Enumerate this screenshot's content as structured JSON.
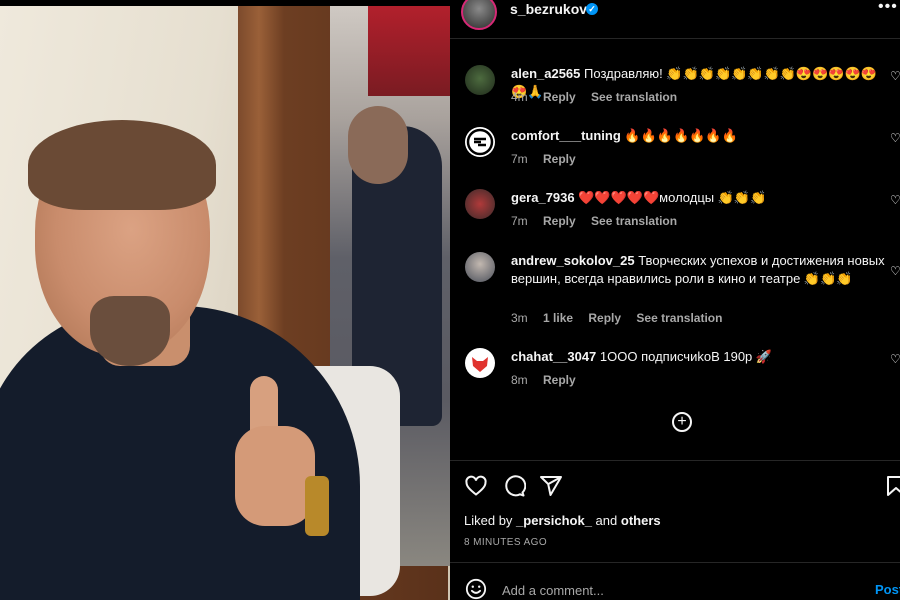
{
  "post": {
    "username": "s_bezrukov",
    "verified_icon": "verified-badge-icon",
    "more_icon": "more-options-icon"
  },
  "comments": [
    {
      "username": "alen_a2565",
      "text": "Поздравляю! 👏👏👏👏👏👏👏👏😍😍😍😍😍😍🙏",
      "time": "4m",
      "likes": "",
      "reply": "Reply",
      "see_translation": "See translation"
    },
    {
      "username": "comfort___tuning",
      "text": "🔥🔥🔥🔥🔥🔥🔥",
      "time": "7m",
      "likes": "",
      "reply": "Reply",
      "see_translation": ""
    },
    {
      "username": "gera_7936",
      "text": "❤️❤️❤️❤️❤️молодцы 👏👏👏",
      "time": "7m",
      "likes": "",
      "reply": "Reply",
      "see_translation": "See translation"
    },
    {
      "username": "andrew_sokolov_25",
      "text": "Творческих успехов и достижения новых вершин, всегда нравились роли в кино и театре 👏👏👏",
      "time": "3m",
      "likes": "1 like",
      "reply": "Reply",
      "see_translation": "See translation"
    },
    {
      "username": "chahat__3047",
      "text": "1OOO подписчиkoB 190р 🚀",
      "time": "8m",
      "likes": "",
      "reply": "Reply",
      "see_translation": ""
    }
  ],
  "actions": {
    "like_icon": "heart-icon",
    "comment_icon": "comment-icon",
    "share_icon": "share-icon",
    "save_icon": "bookmark-icon",
    "add_comments_icon": "plus-circle-icon"
  },
  "liked_by": {
    "prefix": "Liked by",
    "user": "_persichok_",
    "conj": "and",
    "others": "others"
  },
  "post_time": "8 MINUTES AGO",
  "comment_box": {
    "placeholder": "Add a comment...",
    "post_label": "Post",
    "emoji_icon": "emoji-icon"
  },
  "colors": {
    "background": "#000000",
    "text": "#f5f5f5",
    "secondary": "#a8a8a8",
    "accent": "#0095f6"
  }
}
